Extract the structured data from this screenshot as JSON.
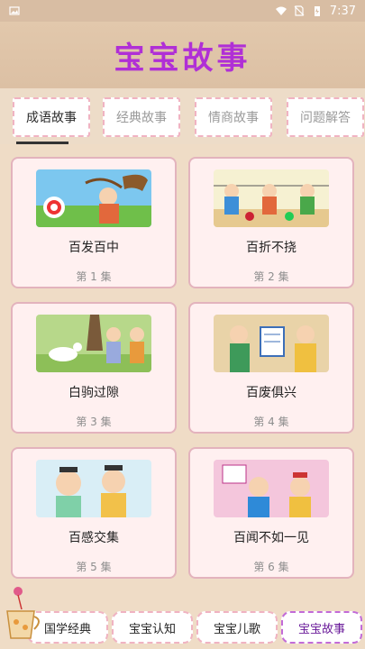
{
  "status": {
    "time": "7:37"
  },
  "header": {
    "title": "宝宝故事"
  },
  "tabs": [
    {
      "label": "成语故事",
      "active": true
    },
    {
      "label": "经典故事",
      "active": false
    },
    {
      "label": "情商故事",
      "active": false
    },
    {
      "label": "问题解答",
      "active": false
    }
  ],
  "stories": [
    {
      "title": "百发百中",
      "episode": "第 1 集"
    },
    {
      "title": "百折不挠",
      "episode": "第 2 集"
    },
    {
      "title": "白驹过隙",
      "episode": "第 3 集"
    },
    {
      "title": "百废俱兴",
      "episode": "第 4 集"
    },
    {
      "title": "百感交集",
      "episode": "第 5 集"
    },
    {
      "title": "百闻不如一见",
      "episode": "第 6 集"
    }
  ],
  "bottom_nav": [
    {
      "label": "国学经典",
      "active": false
    },
    {
      "label": "宝宝认知",
      "active": false
    },
    {
      "label": "宝宝儿歌",
      "active": false
    },
    {
      "label": "宝宝故事",
      "active": true
    }
  ],
  "colors": {
    "accent": "#b02fd6",
    "card_border": "#e3b3bd",
    "tab_border": "#f0b3c2"
  }
}
